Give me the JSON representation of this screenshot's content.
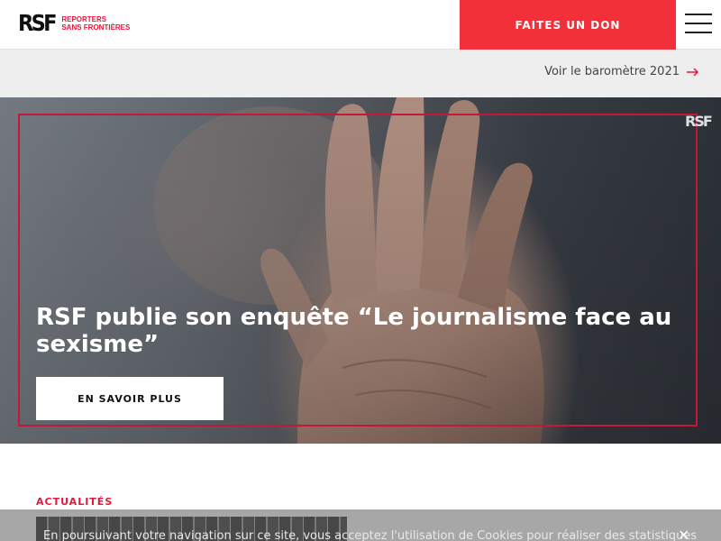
{
  "header": {
    "logo_mark": "RSF",
    "logo_line1": "REPORTERS",
    "logo_line2": "SANS FRONTIÈRES",
    "donate_label": "FAITES UN DON",
    "menu_icon": "hamburger-menu-icon"
  },
  "subbar": {
    "barometer_label": "Voir le baromètre 2021",
    "arrow_icon": "arrow-right-icon"
  },
  "hero": {
    "watermark": "RSF",
    "title": "RSF publie son enquête “Le journalisme face au sexisme”",
    "button_label": "EN SAVOIR PLUS"
  },
  "news": {
    "section_label": "ACTUALITÉS"
  },
  "cookie": {
    "text": "En poursuivant votre navigation sur ce site, vous acceptez l'utilisation de Cookies pour réaliser des statistiques",
    "close_label": "×"
  },
  "colors": {
    "brand_red": "#e8173b",
    "donate_red": "#f2303a",
    "frame_red": "#c2183a"
  }
}
